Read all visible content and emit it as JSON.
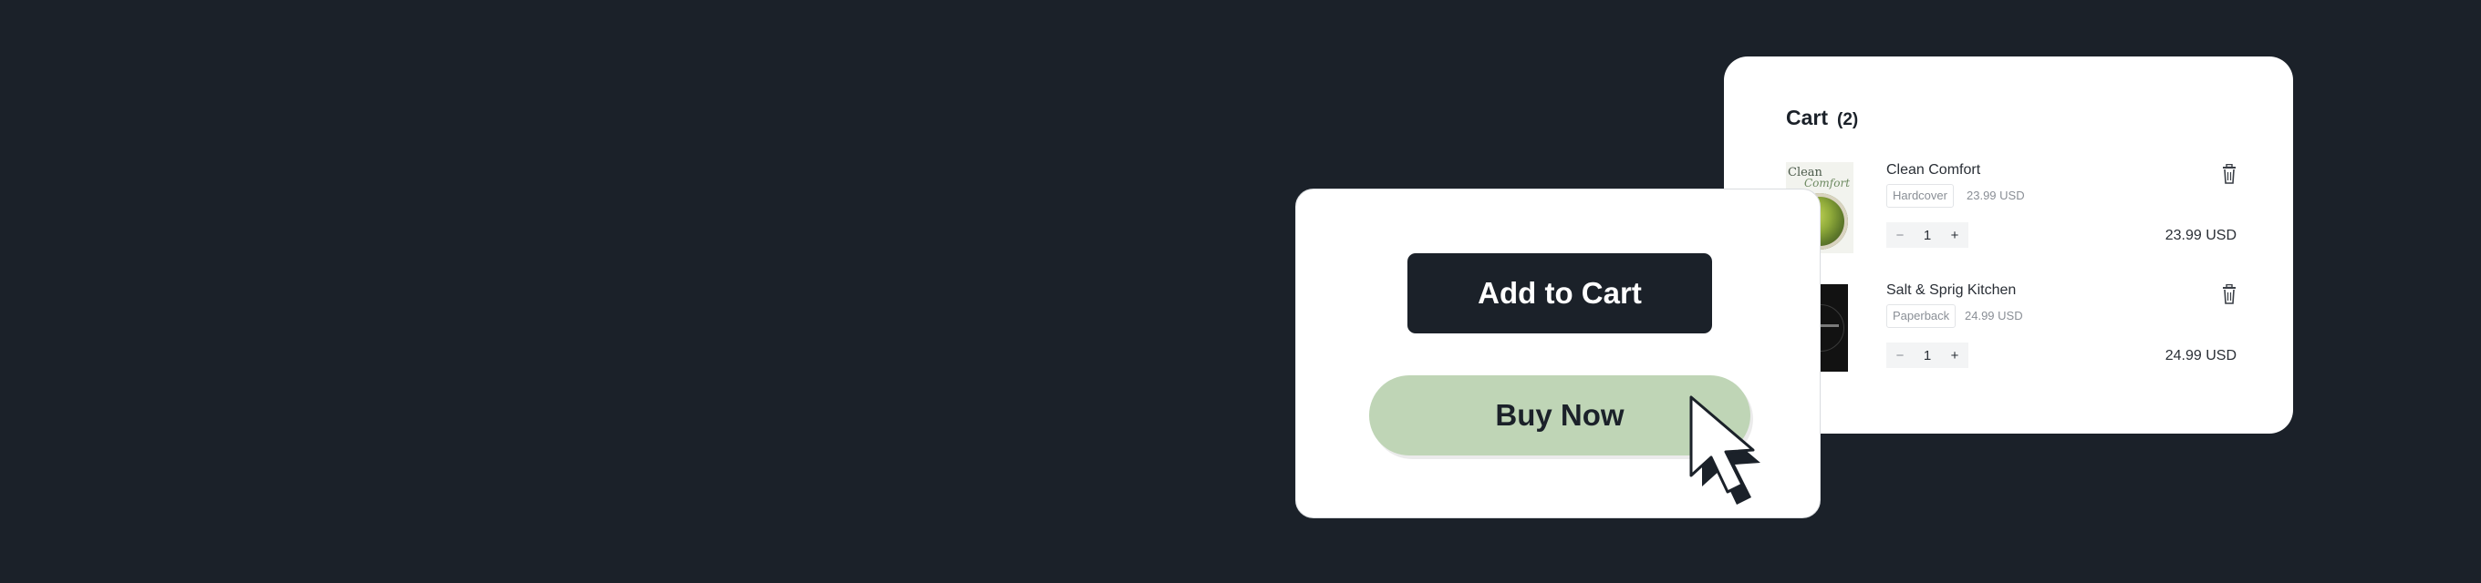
{
  "cart": {
    "title": "Cart",
    "count": "(2)",
    "items": [
      {
        "name": "Clean Comfort",
        "format": "Hardcover",
        "unit_price": "23.99 USD",
        "quantity": "1",
        "line_total": "23.99 USD",
        "thumbnail_text": "Clean",
        "thumbnail_script": "Comfort"
      },
      {
        "name": "Salt & Sprig Kitchen",
        "format": "Paperback",
        "unit_price": "24.99 USD",
        "quantity": "1",
        "line_total": "24.99 USD"
      }
    ],
    "qty_minus": "−",
    "qty_plus": "+"
  },
  "actions": {
    "add_to_cart_label": "Add to Cart",
    "buy_now_label": "Buy Now"
  },
  "colors": {
    "background": "#1b2129",
    "primary_button": "#1b2129",
    "buy_now_button": "#bfd5b6",
    "card": "#ffffff"
  },
  "icons": {
    "delete": "trash-icon",
    "pointer": "mouse-cursor-icon"
  }
}
